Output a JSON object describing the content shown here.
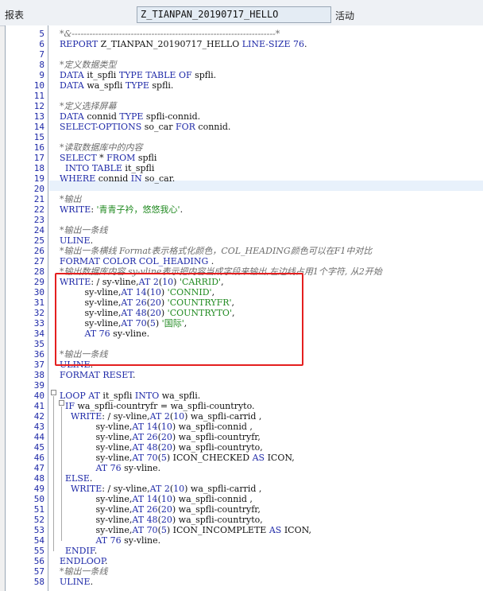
{
  "header": {
    "label": "报表",
    "program": "Z_TIANPAN_20190717_HELLO",
    "status": "活动"
  },
  "editor": {
    "lines": [
      {
        "n": "5",
        "segs": [
          {
            "t": "*&---------------------------------------------------------------------*",
            "c": "cm"
          }
        ]
      },
      {
        "n": "6",
        "segs": [
          {
            "t": "REPORT ",
            "c": "kw"
          },
          {
            "t": "Z_TIANPAN_20190717_HELLO "
          },
          {
            "t": "LINE-SIZE ",
            "c": "kw"
          },
          {
            "t": "76",
            "c": "num"
          },
          {
            "t": "."
          }
        ]
      },
      {
        "n": "7",
        "segs": []
      },
      {
        "n": "8",
        "segs": [
          {
            "t": "*定义数据类型",
            "c": "cm"
          }
        ]
      },
      {
        "n": "9",
        "segs": [
          {
            "t": "DATA ",
            "c": "kw"
          },
          {
            "t": "it_spfli "
          },
          {
            "t": "TYPE TABLE OF ",
            "c": "kw"
          },
          {
            "t": "spfli."
          }
        ]
      },
      {
        "n": "10",
        "segs": [
          {
            "t": "DATA ",
            "c": "kw"
          },
          {
            "t": "wa_spfli "
          },
          {
            "t": "TYPE ",
            "c": "kw"
          },
          {
            "t": "spfli."
          }
        ]
      },
      {
        "n": "11",
        "segs": []
      },
      {
        "n": "12",
        "segs": [
          {
            "t": "*定义选择屏幕",
            "c": "cm"
          }
        ]
      },
      {
        "n": "13",
        "segs": [
          {
            "t": "DATA ",
            "c": "kw"
          },
          {
            "t": "connid "
          },
          {
            "t": "TYPE ",
            "c": "kw"
          },
          {
            "t": "spfli-connid."
          }
        ]
      },
      {
        "n": "14",
        "segs": [
          {
            "t": "SELECT-OPTIONS ",
            "c": "kw"
          },
          {
            "t": "so_car "
          },
          {
            "t": "FOR ",
            "c": "kw"
          },
          {
            "t": "connid."
          }
        ]
      },
      {
        "n": "15",
        "segs": []
      },
      {
        "n": "16",
        "segs": [
          {
            "t": "*读取数据库中的内容",
            "c": "cm"
          }
        ]
      },
      {
        "n": "17",
        "segs": [
          {
            "t": "SELECT ",
            "c": "kw"
          },
          {
            "t": "* "
          },
          {
            "t": "FROM ",
            "c": "kw"
          },
          {
            "t": "spfli"
          }
        ]
      },
      {
        "n": "18",
        "segs": [
          {
            "t": "  INTO TABLE ",
            "c": "kw"
          },
          {
            "t": "it_spfli"
          }
        ]
      },
      {
        "n": "19",
        "segs": [
          {
            "t": "WHERE ",
            "c": "kw"
          },
          {
            "t": "connid "
          },
          {
            "t": "IN ",
            "c": "kw"
          },
          {
            "t": "so_car."
          }
        ]
      },
      {
        "n": "20",
        "segs": []
      },
      {
        "n": "21",
        "segs": [
          {
            "t": "*输出",
            "c": "cm"
          }
        ]
      },
      {
        "n": "22",
        "segs": [
          {
            "t": "WRITE",
            "c": "kw"
          },
          {
            "t": ": "
          },
          {
            "t": "'青青子衿，悠悠我心'",
            "c": "str"
          },
          {
            "t": "."
          }
        ]
      },
      {
        "n": "23",
        "segs": []
      },
      {
        "n": "24",
        "segs": [
          {
            "t": "*输出一条线",
            "c": "cm"
          }
        ]
      },
      {
        "n": "25",
        "segs": [
          {
            "t": "ULINE",
            "c": "kw"
          },
          {
            "t": "."
          }
        ]
      },
      {
        "n": "26",
        "segs": [
          {
            "t": "*输出一条横线 Format表示格式化颜色，COL_HEADING颜色可以在F1中对比",
            "c": "cm"
          }
        ]
      },
      {
        "n": "27",
        "segs": [
          {
            "t": "FORMAT COLOR COL_HEADING ",
            "c": "kw"
          },
          {
            "t": "."
          }
        ]
      },
      {
        "n": "28",
        "segs": [
          {
            "t": "*输出数据库内容 sy-vline表示把内容当成字段来输出,左边线占用1个字符, 从2开始",
            "c": "cm"
          }
        ]
      },
      {
        "n": "29",
        "segs": [
          {
            "t": "WRITE",
            "c": "kw"
          },
          {
            "t": ": / sy-vline,"
          },
          {
            "t": "AT ",
            "c": "kw"
          },
          {
            "t": "2",
            "c": "num"
          },
          {
            "t": "("
          },
          {
            "t": "10",
            "c": "num"
          },
          {
            "t": ") "
          },
          {
            "t": "'CARRID'",
            "c": "str"
          },
          {
            "t": ","
          }
        ]
      },
      {
        "n": "30",
        "segs": [
          {
            "t": "         sy-vline,"
          },
          {
            "t": "AT ",
            "c": "kw"
          },
          {
            "t": "14",
            "c": "num"
          },
          {
            "t": "("
          },
          {
            "t": "10",
            "c": "num"
          },
          {
            "t": ") "
          },
          {
            "t": "'CONNID'",
            "c": "str"
          },
          {
            "t": ","
          }
        ]
      },
      {
        "n": "31",
        "segs": [
          {
            "t": "         sy-vline,"
          },
          {
            "t": "AT ",
            "c": "kw"
          },
          {
            "t": "26",
            "c": "num"
          },
          {
            "t": "("
          },
          {
            "t": "20",
            "c": "num"
          },
          {
            "t": ") "
          },
          {
            "t": "'COUNTRYFR'",
            "c": "str"
          },
          {
            "t": ","
          }
        ]
      },
      {
        "n": "32",
        "segs": [
          {
            "t": "         sy-vline,"
          },
          {
            "t": "AT ",
            "c": "kw"
          },
          {
            "t": "48",
            "c": "num"
          },
          {
            "t": "("
          },
          {
            "t": "20",
            "c": "num"
          },
          {
            "t": ") "
          },
          {
            "t": "'COUNTRYTO'",
            "c": "str"
          },
          {
            "t": ","
          }
        ]
      },
      {
        "n": "33",
        "segs": [
          {
            "t": "         sy-vline,"
          },
          {
            "t": "AT ",
            "c": "kw"
          },
          {
            "t": "70",
            "c": "num"
          },
          {
            "t": "("
          },
          {
            "t": "5",
            "c": "num"
          },
          {
            "t": ") "
          },
          {
            "t": "'国际'",
            "c": "str"
          },
          {
            "t": ","
          }
        ]
      },
      {
        "n": "34",
        "segs": [
          {
            "t": "         "
          },
          {
            "t": "AT ",
            "c": "kw"
          },
          {
            "t": "76",
            "c": "num"
          },
          {
            "t": " sy-vline."
          }
        ]
      },
      {
        "n": "35",
        "segs": []
      },
      {
        "n": "36",
        "segs": [
          {
            "t": "*输出一条线",
            "c": "cm"
          }
        ]
      },
      {
        "n": "37",
        "segs": [
          {
            "t": "ULINE",
            "c": "kw"
          },
          {
            "t": "."
          }
        ]
      },
      {
        "n": "38",
        "segs": [
          {
            "t": "FORMAT RESET",
            "c": "kw"
          },
          {
            "t": "."
          }
        ]
      },
      {
        "n": "39",
        "segs": []
      },
      {
        "n": "40",
        "segs": [
          {
            "t": "LOOP AT ",
            "c": "kw"
          },
          {
            "t": "it_spfli "
          },
          {
            "t": "INTO ",
            "c": "kw"
          },
          {
            "t": "wa_spfli."
          }
        ]
      },
      {
        "n": "41",
        "segs": [
          {
            "t": "  IF ",
            "c": "kw"
          },
          {
            "t": "wa_spfli-countryfr = wa_spfli-countryto."
          }
        ]
      },
      {
        "n": "42",
        "segs": [
          {
            "t": "    WRITE",
            "c": "kw"
          },
          {
            "t": ": / sy-vline,"
          },
          {
            "t": "AT ",
            "c": "kw"
          },
          {
            "t": "2",
            "c": "num"
          },
          {
            "t": "("
          },
          {
            "t": "10",
            "c": "num"
          },
          {
            "t": ") wa_spfli-carrid ,"
          }
        ]
      },
      {
        "n": "43",
        "segs": [
          {
            "t": "             sy-vline,"
          },
          {
            "t": "AT ",
            "c": "kw"
          },
          {
            "t": "14",
            "c": "num"
          },
          {
            "t": "("
          },
          {
            "t": "10",
            "c": "num"
          },
          {
            "t": ") wa_spfli-connid ,"
          }
        ]
      },
      {
        "n": "44",
        "segs": [
          {
            "t": "             sy-vline,"
          },
          {
            "t": "AT ",
            "c": "kw"
          },
          {
            "t": "26",
            "c": "num"
          },
          {
            "t": "("
          },
          {
            "t": "20",
            "c": "num"
          },
          {
            "t": ") wa_spfli-countryfr,"
          }
        ]
      },
      {
        "n": "45",
        "segs": [
          {
            "t": "             sy-vline,"
          },
          {
            "t": "AT ",
            "c": "kw"
          },
          {
            "t": "48",
            "c": "num"
          },
          {
            "t": "("
          },
          {
            "t": "20",
            "c": "num"
          },
          {
            "t": ") wa_spfli-countryto,"
          }
        ]
      },
      {
        "n": "46",
        "segs": [
          {
            "t": "             sy-vline,"
          },
          {
            "t": "AT ",
            "c": "kw"
          },
          {
            "t": "70",
            "c": "num"
          },
          {
            "t": "("
          },
          {
            "t": "5",
            "c": "num"
          },
          {
            "t": ") ICON_CHECKED "
          },
          {
            "t": "AS ",
            "c": "kw"
          },
          {
            "t": "ICON,"
          }
        ]
      },
      {
        "n": "47",
        "segs": [
          {
            "t": "             "
          },
          {
            "t": "AT ",
            "c": "kw"
          },
          {
            "t": "76",
            "c": "num"
          },
          {
            "t": " sy-vline."
          }
        ]
      },
      {
        "n": "48",
        "segs": [
          {
            "t": "  ELSE",
            "c": "kw"
          },
          {
            "t": "."
          }
        ]
      },
      {
        "n": "49",
        "segs": [
          {
            "t": "    WRITE",
            "c": "kw"
          },
          {
            "t": ": / sy-vline,"
          },
          {
            "t": "AT ",
            "c": "kw"
          },
          {
            "t": "2",
            "c": "num"
          },
          {
            "t": "("
          },
          {
            "t": "10",
            "c": "num"
          },
          {
            "t": ") wa_spfli-carrid ,"
          }
        ]
      },
      {
        "n": "50",
        "segs": [
          {
            "t": "             sy-vline,"
          },
          {
            "t": "AT ",
            "c": "kw"
          },
          {
            "t": "14",
            "c": "num"
          },
          {
            "t": "("
          },
          {
            "t": "10",
            "c": "num"
          },
          {
            "t": ") wa_spfli-connid ,"
          }
        ]
      },
      {
        "n": "51",
        "segs": [
          {
            "t": "             sy-vline,"
          },
          {
            "t": "AT ",
            "c": "kw"
          },
          {
            "t": "26",
            "c": "num"
          },
          {
            "t": "("
          },
          {
            "t": "20",
            "c": "num"
          },
          {
            "t": ") wa_spfli-countryfr,"
          }
        ]
      },
      {
        "n": "52",
        "segs": [
          {
            "t": "             sy-vline,"
          },
          {
            "t": "AT ",
            "c": "kw"
          },
          {
            "t": "48",
            "c": "num"
          },
          {
            "t": "("
          },
          {
            "t": "20",
            "c": "num"
          },
          {
            "t": ") wa_spfli-countryto,"
          }
        ]
      },
      {
        "n": "53",
        "segs": [
          {
            "t": "             sy-vline,"
          },
          {
            "t": "AT ",
            "c": "kw"
          },
          {
            "t": "70",
            "c": "num"
          },
          {
            "t": "("
          },
          {
            "t": "5",
            "c": "num"
          },
          {
            "t": ") ICON_INCOMPLETE "
          },
          {
            "t": "AS ",
            "c": "kw"
          },
          {
            "t": "ICON,"
          }
        ]
      },
      {
        "n": "54",
        "segs": [
          {
            "t": "             "
          },
          {
            "t": "AT ",
            "c": "kw"
          },
          {
            "t": "76",
            "c": "num"
          },
          {
            "t": " sy-vline."
          }
        ]
      },
      {
        "n": "55",
        "segs": [
          {
            "t": "  ENDIF",
            "c": "kw"
          },
          {
            "t": "."
          }
        ]
      },
      {
        "n": "56",
        "segs": [
          {
            "t": "ENDLOOP",
            "c": "kw"
          },
          {
            "t": "."
          }
        ]
      },
      {
        "n": "57",
        "segs": [
          {
            "t": "*输出一条线",
            "c": "cm"
          }
        ]
      },
      {
        "n": "58",
        "segs": [
          {
            "t": "ULINE",
            "c": "kw"
          },
          {
            "t": "."
          }
        ]
      }
    ]
  }
}
